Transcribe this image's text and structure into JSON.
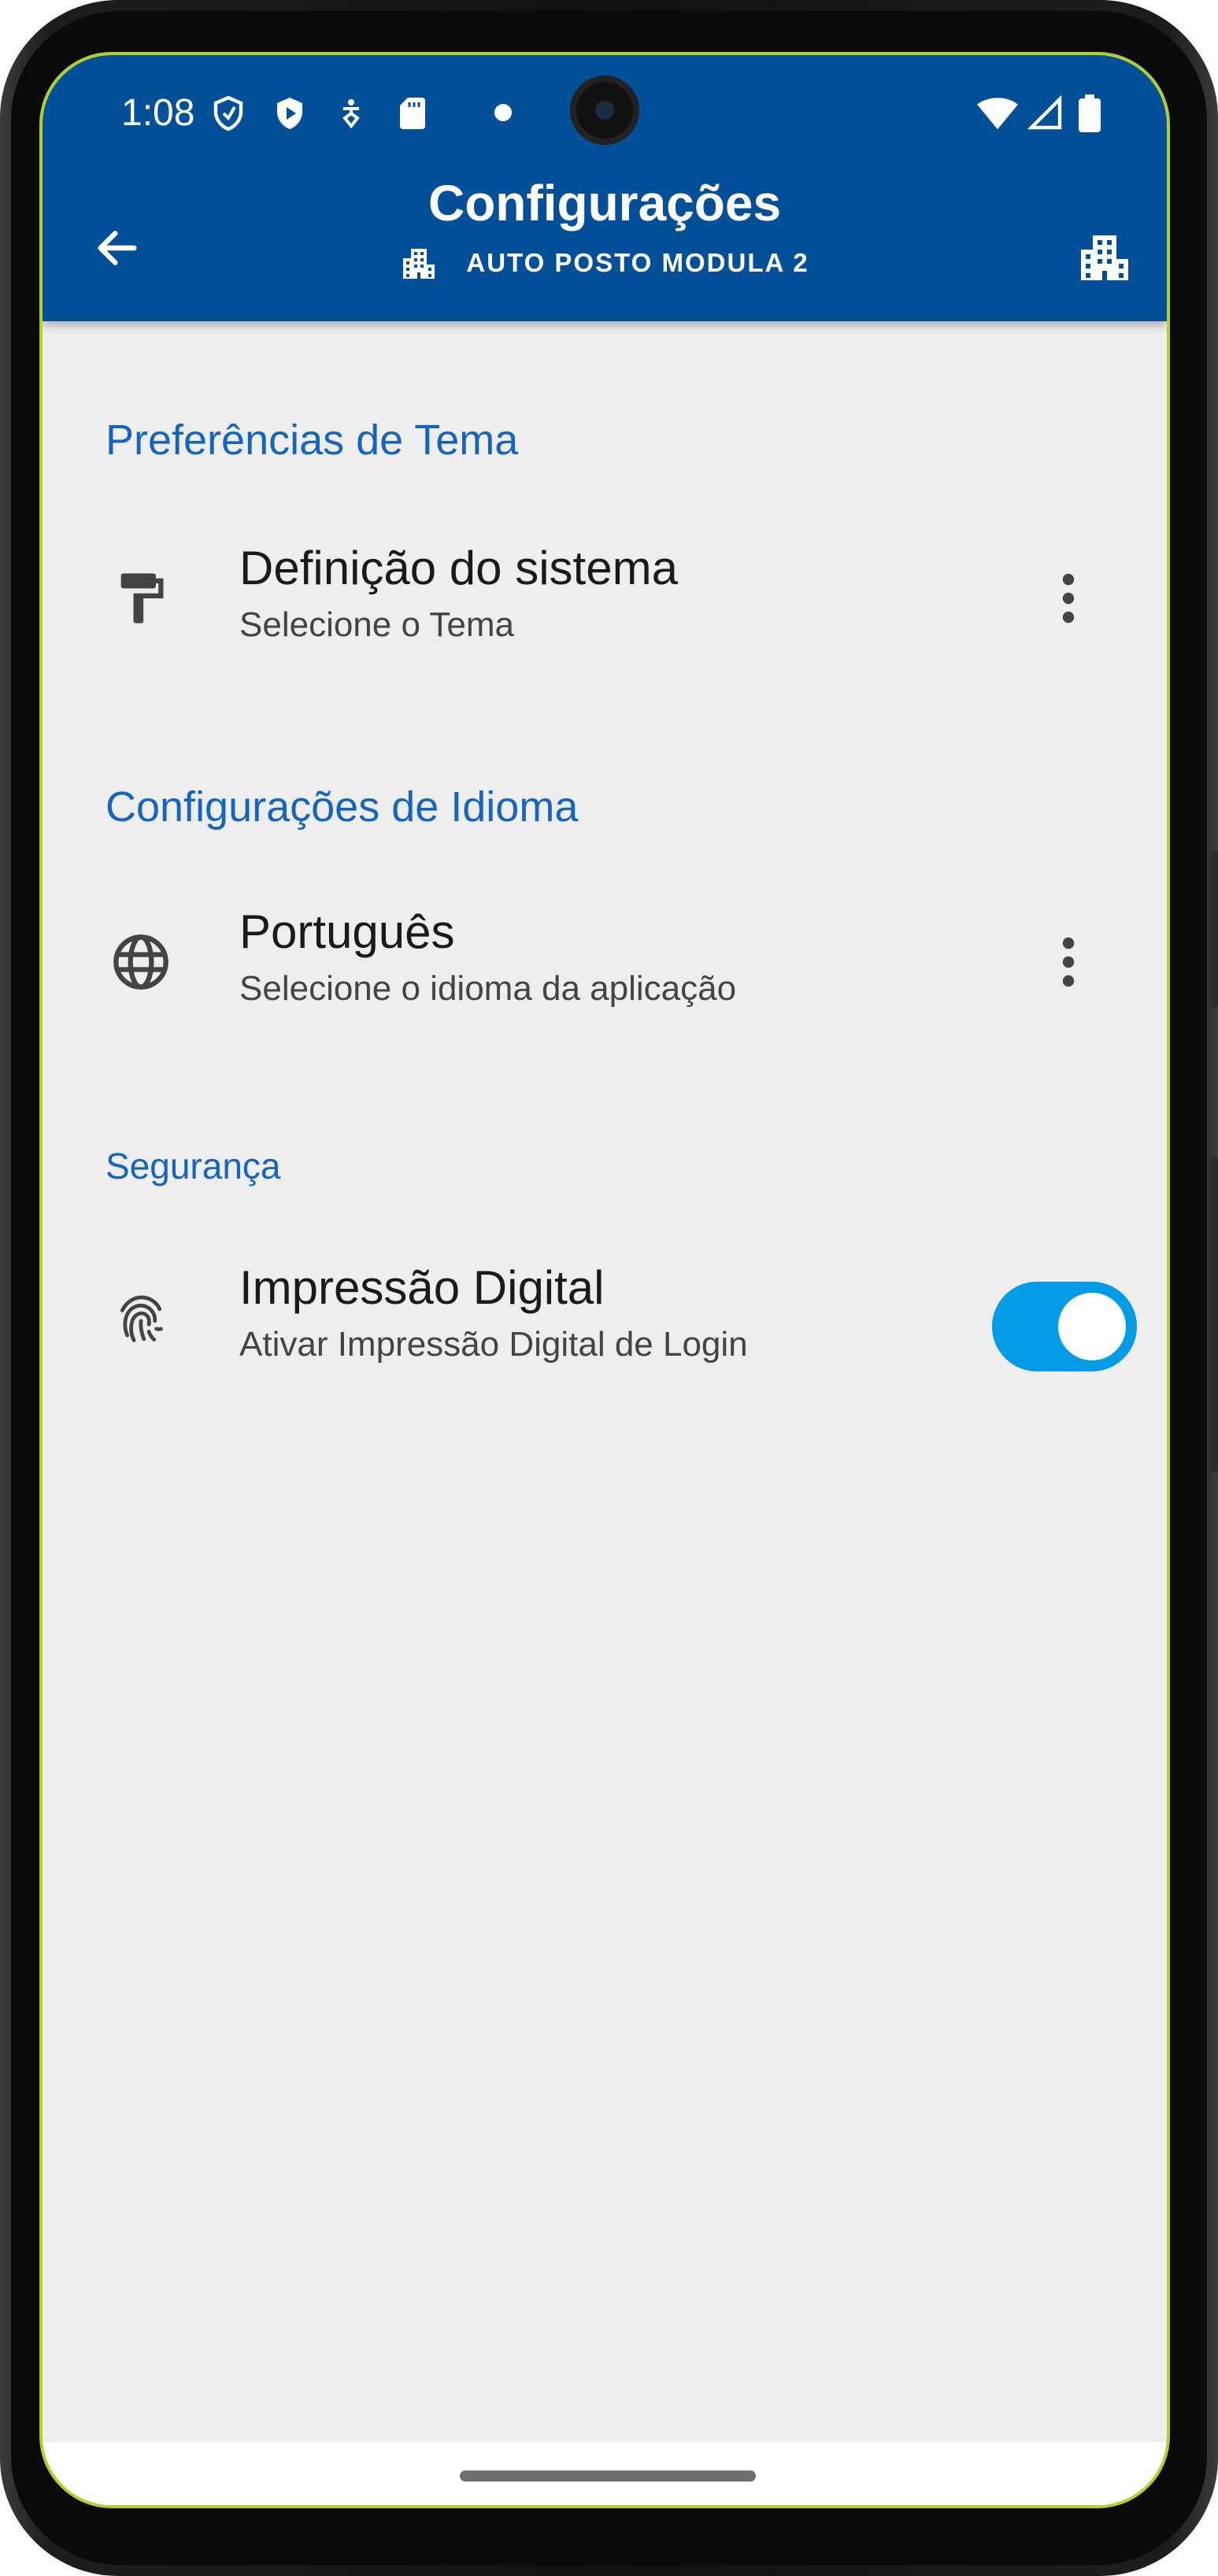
{
  "status_bar": {
    "time": "1:08"
  },
  "app_bar": {
    "title": "Configurações",
    "subtitle": "AUTO POSTO MODULA 2",
    "background_color": "#034f98"
  },
  "sections": {
    "theme": {
      "header": "Preferências de Tema",
      "item_title": "Definição do sistema",
      "item_subtitle": "Selecione o Tema",
      "icon": "paint-roller-icon"
    },
    "language": {
      "header": "Configurações de Idioma",
      "item_title": "Português",
      "item_subtitle": "Selecione o idioma da aplicação",
      "icon": "globe-icon"
    },
    "security": {
      "header": "Segurança",
      "item_title": "Impressão Digital",
      "item_subtitle": "Ativar Impressão Digital de Login",
      "icon": "fingerprint-icon",
      "toggle_on": true,
      "toggle_color": "#039be5"
    }
  },
  "colors": {
    "accent": "#1565c0",
    "screen_background": "#eeeeee"
  }
}
